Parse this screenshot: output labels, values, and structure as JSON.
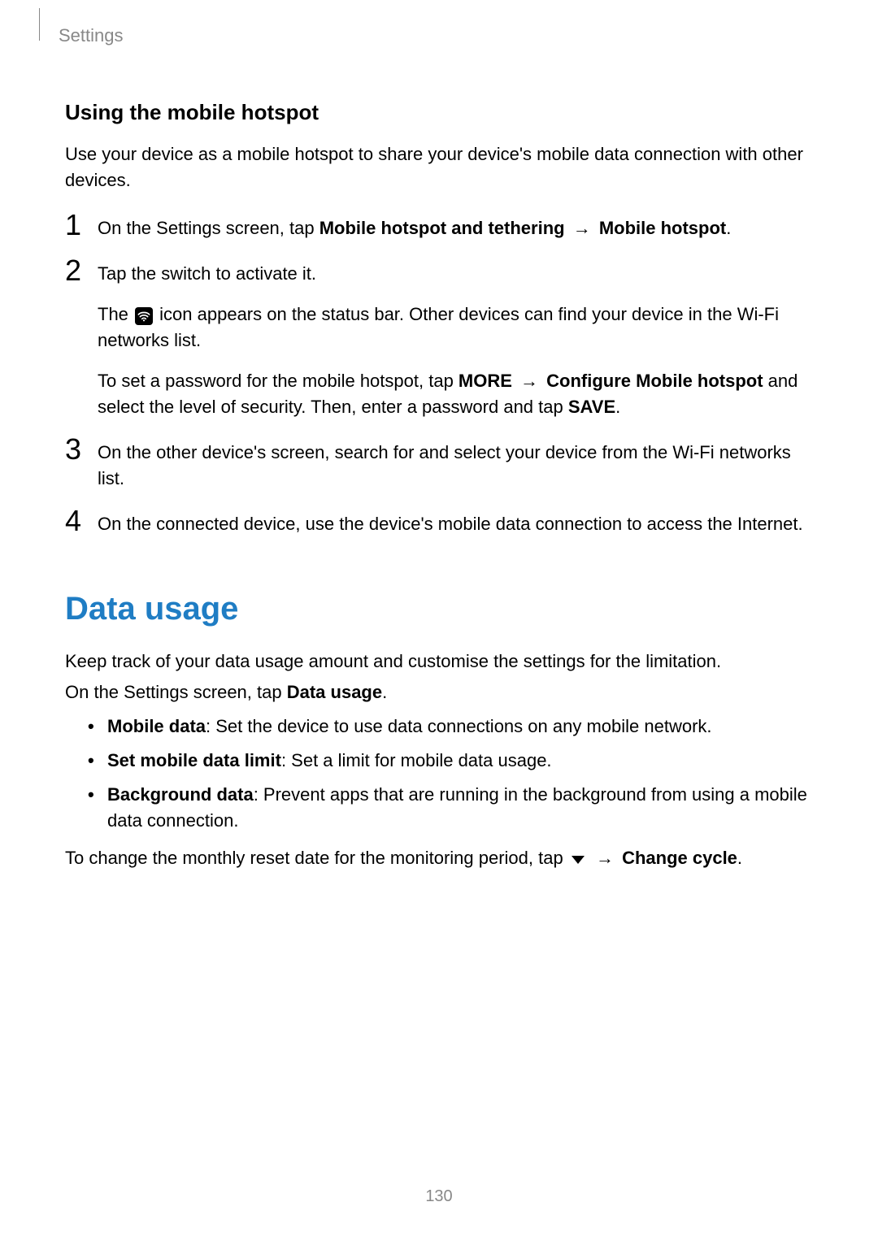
{
  "header": {
    "section": "Settings"
  },
  "section1": {
    "heading": "Using the mobile hotspot",
    "intro": "Use your device as a mobile hotspot to share your device's mobile data connection with other devices.",
    "steps": [
      {
        "num": "1",
        "pre": "On the Settings screen, tap ",
        "bold1": "Mobile hotspot and tethering",
        "arrow": " → ",
        "bold2": "Mobile hotspot",
        "post": "."
      },
      {
        "num": "2",
        "line1": "Tap the switch to activate it.",
        "line2_pre": "The ",
        "line2_post": " icon appears on the status bar. Other devices can find your device in the Wi-Fi networks list.",
        "line3_pre": "To set a password for the mobile hotspot, tap ",
        "line3_b1": "MORE",
        "line3_arrow": " → ",
        "line3_b2": "Configure Mobile hotspot",
        "line3_mid": " and select the level of security. Then, enter a password and tap ",
        "line3_b3": "SAVE",
        "line3_post": "."
      },
      {
        "num": "3",
        "text": "On the other device's screen, search for and select your device from the Wi-Fi networks list."
      },
      {
        "num": "4",
        "text": "On the connected device, use the device's mobile data connection to access the Internet."
      }
    ]
  },
  "section2": {
    "title": "Data usage",
    "p1": "Keep track of your data usage amount and customise the settings for the limitation.",
    "p2_pre": "On the Settings screen, tap ",
    "p2_bold": "Data usage",
    "p2_post": ".",
    "bullets": [
      {
        "bold": "Mobile data",
        "rest": ": Set the device to use data connections on any mobile network."
      },
      {
        "bold": "Set mobile data limit",
        "rest": ": Set a limit for mobile data usage."
      },
      {
        "bold": "Background data",
        "rest": ": Prevent apps that are running in the background from using a mobile data connection."
      }
    ],
    "p3_pre": "To change the monthly reset date for the monitoring period, tap ",
    "p3_arrow": " → ",
    "p3_bold": "Change cycle",
    "p3_post": "."
  },
  "pageNumber": "130"
}
